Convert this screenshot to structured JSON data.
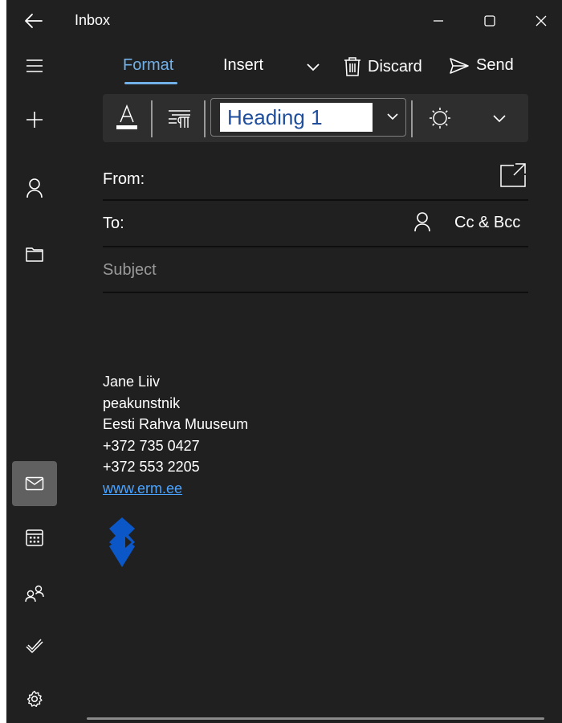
{
  "window": {
    "title": "Inbox"
  },
  "tabs": [
    {
      "label": "Format",
      "active": true
    },
    {
      "label": "Insert",
      "active": false
    }
  ],
  "actions": {
    "discard_label": "Discard",
    "send_label": "Send"
  },
  "format_toolbar": {
    "paragraph_style": "Heading 1"
  },
  "fields": {
    "from_label": "From:",
    "to_label": "To:",
    "cc_bcc_label": "Cc & Bcc",
    "subject_placeholder": "Subject"
  },
  "signature": {
    "lines": [
      "Jane Liiv",
      "peakunstnik",
      "Eesti Rahva Muuseum",
      "+372 735 0427",
      "+372 553 2205"
    ],
    "link": "www.erm.ee"
  },
  "sidebar": {
    "items": [
      {
        "icon": "hamburger-menu-icon"
      },
      {
        "icon": "new-mail-plus-icon"
      },
      {
        "icon": "person-icon"
      },
      {
        "icon": "folder-icon"
      },
      {
        "icon": "mail-icon",
        "active": true
      },
      {
        "icon": "calendar-icon"
      },
      {
        "icon": "people-icon"
      },
      {
        "icon": "todo-check-icon"
      },
      {
        "icon": "settings-gear-icon"
      }
    ]
  },
  "colors": {
    "background": "#202020",
    "accent": "#72b0e8",
    "link": "#4aa3ff",
    "logo": "#0b57c8"
  }
}
